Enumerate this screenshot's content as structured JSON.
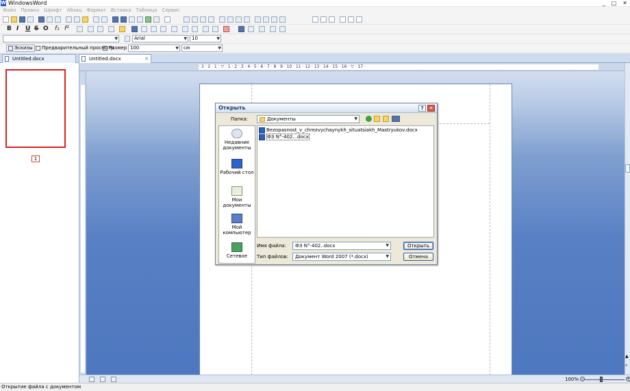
{
  "app": {
    "title": "WindowsWord",
    "icon_letter": "W",
    "win_buttons": [
      "_",
      "□",
      "✕"
    ]
  },
  "menu": [
    "Файл",
    "Правка",
    "Шрифт",
    "Абзац",
    "Формат",
    "Вставка",
    "Таблица",
    "Сервис"
  ],
  "format_bar": {
    "bold": "B",
    "italic": "I",
    "underline": "U",
    "strike": "S",
    "outline": "O",
    "subscript": "f₁",
    "superscript": "f²"
  },
  "font_bar": {
    "style_value": "",
    "font_value": "Arial",
    "size_value": "10"
  },
  "mode_bar": {
    "draft": "Эскизы",
    "preview": "Предварительный просмотр",
    "size": "Размер",
    "size_value": "100",
    "unit_value": "см"
  },
  "tabs": [
    {
      "label": "Untitled.docx",
      "active": false
    },
    {
      "label": "Untitled.docx",
      "active": true
    }
  ],
  "thumbnails": {
    "page_number": "1"
  },
  "ruler": {
    "top_text": "· 3 · 2 · 1 · ▽ · 1 · 2 · 3 · 4 · 5 · 6 · 7 · 8 · 9 · 10 · 11 · 12 · 13 · 14 · 15 · 16 · ▽ · 17 ·"
  },
  "dialog": {
    "title": "Открыть",
    "help": "?",
    "close": "✕",
    "folder_label": "Папка:",
    "folder_value": "Документы",
    "places": [
      "Недавние документы",
      "Рабочий стол",
      "Мои документы",
      "Мой компьютер",
      "Сетевое"
    ],
    "files": [
      "Bezopasnost_v_chrezvychaynykh_situatsiakh_Mastryukov.docx",
      "ФЗ N°-402...docx"
    ],
    "filename_label": "Имя файла:",
    "filename_value": "ФЗ N°-402..docx",
    "filetype_label": "Тип файлов:",
    "filetype_value": "Документ Word 2007 (*.docx)",
    "open_button": "Открыть",
    "cancel_button": "Отмена"
  },
  "statusbar": {
    "zoom": "100%",
    "zoom_level": 0.42,
    "message": "Открытие файла с документом"
  }
}
